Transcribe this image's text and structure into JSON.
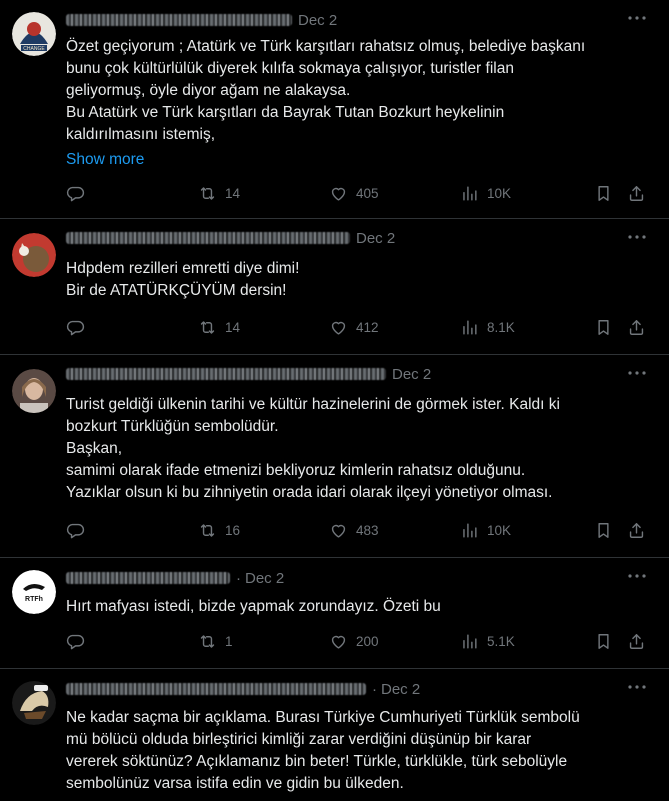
{
  "tweets": [
    {
      "date": "Dec 2",
      "text": "Özet geçiyorum ; Atatürk ve Türk karşıtları rahatsız olmuş, belediye başkanı\nbunu çok kültürlülük diyerek kılıfa sokmaya çalışıyor, turistler filan\ngeliyormuş, öyle diyor ağam ne alakaysa.\nBu Atatürk ve Türk karşıtları da Bayrak Tutan Bozkurt heykelinin\nkaldırılmasını istemiş,",
      "show_more": "Show more",
      "retweets": "14",
      "likes": "405",
      "views": "10K",
      "avatar_caption": "CHANGE"
    },
    {
      "date": "Dec 2",
      "text": "Hdpdem rezilleri emretti diye dimi!\nBir de ATATÜRKÇÜYÜM dersin!",
      "retweets": "14",
      "likes": "412",
      "views": "8.1K"
    },
    {
      "date": "Dec 2",
      "text": "Turist geldiği ülkenin tarihi ve kültür hazinelerini de görmek ister. Kaldı ki\nbozkurt Türklüğün sembolüdür.\nBaşkan,\nsamimi olarak ifade etmenizi bekliyoruz kimlerin rahatsız olduğunu.\nYazıklar olsun ki bu zihniyetin orada idari olarak ilçeyi yönetiyor olması.",
      "retweets": "16",
      "likes": "483",
      "views": "10K"
    },
    {
      "date": "Dec 2",
      "text": "Hırt mafyası istedi, bizde yapmak zorundayız. Özeti bu",
      "retweets": "1",
      "likes": "200",
      "views": "5.1K",
      "avatar_caption": "RTFh"
    },
    {
      "date": "Dec 2",
      "text": "Ne kadar saçma bir açıklama. Burası Türkiye Cumhuriyeti Türklük sembolü\nmü bölücü olduda birleştirici kimliği zarar verdiğini düşünüp bir karar\nvererek söktünüz? Açıklamanız bin beter! Türkle, türklükle, türk sebolüyle\nsembolünüz varsa istifa edin ve gidin bu ülkeden."
    }
  ],
  "colors": {
    "background": "#000000",
    "text": "#e7e9ea",
    "muted": "#71767b",
    "link": "#1d9bf0",
    "divider": "#2f3336"
  },
  "icons": [
    "reply-icon",
    "retweet-icon",
    "like-icon",
    "views-icon",
    "bookmark-icon",
    "share-icon",
    "more-icon"
  ]
}
